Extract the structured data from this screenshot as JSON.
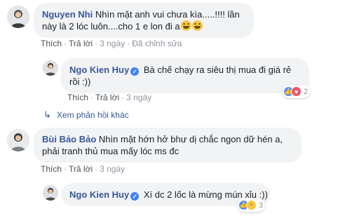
{
  "comments": [
    {
      "author": "Nguyen Nhi",
      "text": "Nhìn mặt anh vui chưa kìa.....!!!! lần này là 2 lóc luôn....cho 1 e lon đi a",
      "emoji": [
        "grinning-squint-face",
        "grinning-squint-face"
      ],
      "actions": {
        "like": "Thích",
        "reply": "Trả lời",
        "time": "3 ngày",
        "edited": "Đã chỉnh sửa"
      }
    },
    {
      "author": "Ngo Kien Huy",
      "verified": true,
      "text": "Bà chế chạy ra siêu thị mua đi giá rẻ rồi :))",
      "actions": {
        "like": "Thích",
        "reply": "Trả lời",
        "time": "3 ngày"
      },
      "reactions": {
        "icons": [
          "like",
          "love"
        ],
        "count": "2"
      }
    },
    {
      "view_more": "Xem phản hồi khác"
    },
    {
      "author": "Bùi Bảo Bảo",
      "text": "Nhìn mặt hớn hở bhư dị chắc ngon dữ hén a, phải tranh thủ mua mấy lóc ms đc",
      "actions": {
        "like": "Thích",
        "reply": "Trả lời",
        "time": "3 ngày"
      }
    },
    {
      "author": "Ngo Kien Huy",
      "verified": true,
      "text": "Xí dc 2 lốc là mừng mún xỉu :))",
      "reactions": {
        "icons": [
          "like",
          "haha"
        ],
        "count": "3"
      }
    }
  ],
  "colors": {
    "name": "#385898",
    "bubble": "#f2f3f5",
    "meta": "#90949c",
    "like": "#5890ff",
    "love": "#f25268",
    "haha": "#f7c840"
  }
}
